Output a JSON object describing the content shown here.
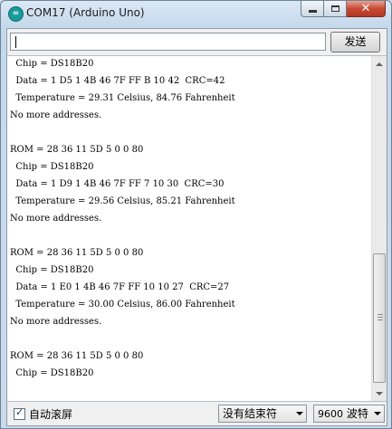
{
  "window": {
    "title": "COM17 (Arduino Uno)",
    "app_icon": "arduino-logo-icon",
    "caption_buttons": [
      "minimize-icon",
      "maximize-icon",
      "close-icon"
    ],
    "close_glyph": "✕"
  },
  "send": {
    "input_value": "",
    "button_label": "发送"
  },
  "serial_lines": [
    "  Chip = DS18B20",
    "  Data = 1 D5 1 4B 46 7F FF B 10 42  CRC=42",
    "  Temperature = 29.31 Celsius, 84.76 Fahrenheit",
    "No more addresses.",
    "",
    "ROM = 28 36 11 5D 5 0 0 80",
    "  Chip = DS18B20",
    "  Data = 1 D9 1 4B 46 7F FF 7 10 30  CRC=30",
    "  Temperature = 29.56 Celsius, 85.21 Fahrenheit",
    "No more addresses.",
    "",
    "ROM = 28 36 11 5D 5 0 0 80",
    "  Chip = DS18B20",
    "  Data = 1 E0 1 4B 46 7F FF 10 10 27  CRC=27",
    "  Temperature = 30.00 Celsius, 86.00 Fahrenheit",
    "No more addresses.",
    "",
    "ROM = 28 36 11 5D 5 0 0 80",
    "  Chip = DS18B20"
  ],
  "footer": {
    "autoscroll_label": "自动滚屏",
    "autoscroll_checked": true,
    "line_ending_value": "没有结束符",
    "baud_number": "9600",
    "baud_unit": "波特"
  },
  "colors": {
    "titlebar": "#c5d9ec",
    "close_button": "#c74a34",
    "console_bg": "#ffffff"
  }
}
